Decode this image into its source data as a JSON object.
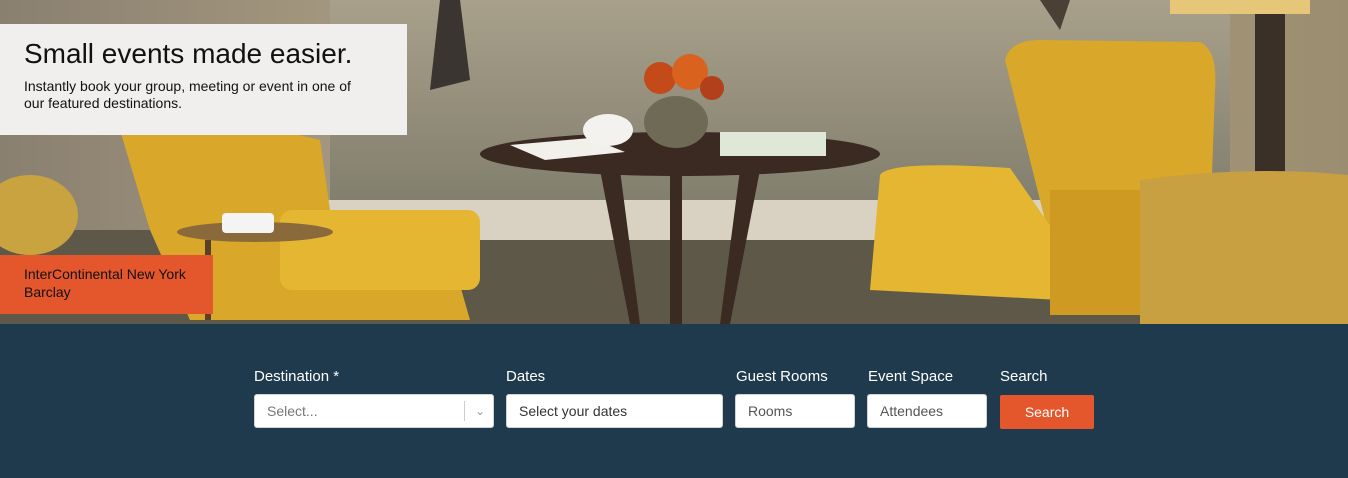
{
  "promo": {
    "title": "Small events made easier.",
    "subtitle": "Instantly book your group, meeting or event in one of our featured destinations."
  },
  "hotel": {
    "name": "InterContinental New York Barclay"
  },
  "search": {
    "destination_label": "Destination *",
    "destination_placeholder": "Select...",
    "dates_label": "Dates",
    "dates_placeholder": "Select your dates",
    "rooms_label": "Guest Rooms",
    "rooms_placeholder": "Rooms",
    "space_label": "Event Space",
    "space_placeholder": "Attendees",
    "search_label": "Search",
    "search_button": "Search"
  },
  "colors": {
    "accent": "#e4562c",
    "bar": "#1e3a4c",
    "promo_bg": "#f1efed"
  }
}
